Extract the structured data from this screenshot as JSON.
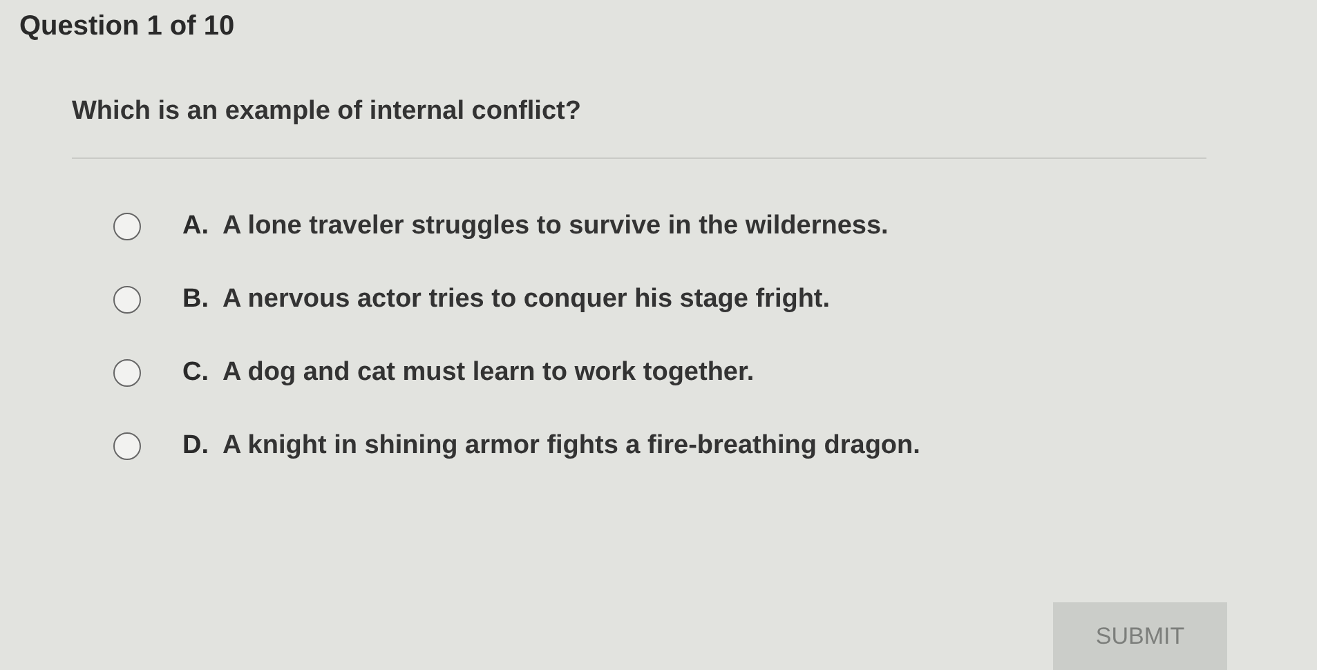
{
  "header": {
    "title": "Question 1 of 10"
  },
  "question": {
    "text": "Which is an example of internal conflict?"
  },
  "options": [
    {
      "letter": "A.",
      "text": "A lone traveler struggles to survive in the wilderness.",
      "selected": false
    },
    {
      "letter": "B.",
      "text": "A nervous actor tries to conquer his stage fright.",
      "selected": false
    },
    {
      "letter": "C.",
      "text": "A dog and cat must learn to work together.",
      "selected": false
    },
    {
      "letter": "D.",
      "text": "A knight in shining armor fights a fire-breathing dragon.",
      "selected": false
    }
  ],
  "submit": {
    "label": "SUBMIT",
    "disabled": true
  }
}
